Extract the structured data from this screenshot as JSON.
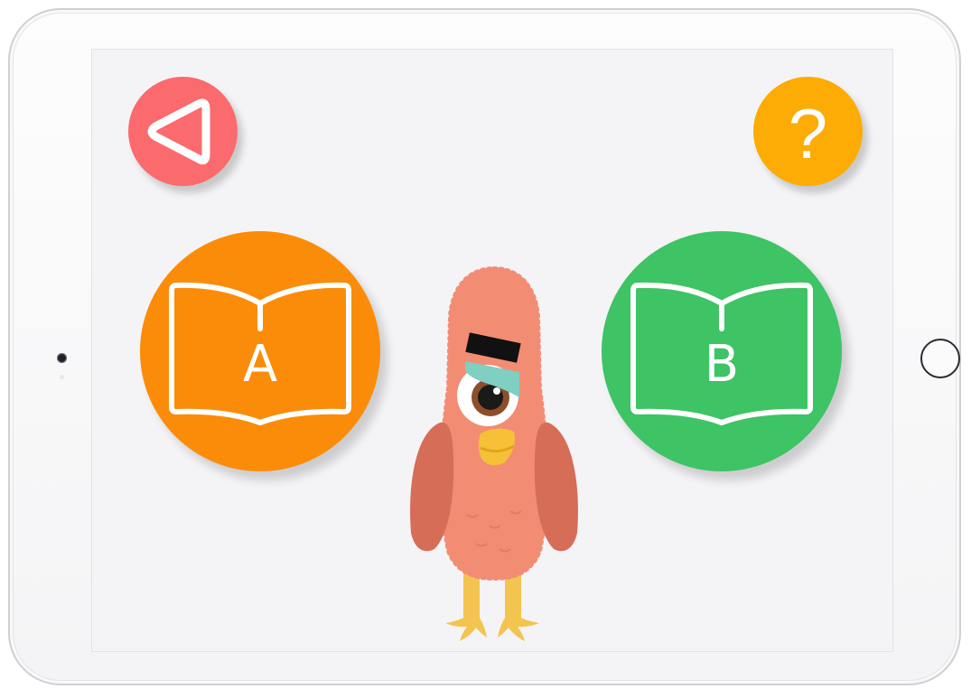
{
  "screen": {
    "back_button": {
      "icon": "back-triangle-icon",
      "color": "#fb6a6d"
    },
    "help_button": {
      "label": "?",
      "icon": "question-icon",
      "color": "#fdab05"
    },
    "books": [
      {
        "letter": "A",
        "icon": "open-book-icon",
        "color": "#fb8c0a"
      },
      {
        "letter": "B",
        "icon": "open-book-icon",
        "color": "#3ec365"
      }
    ],
    "mascot": {
      "icon": "bird-mascot"
    }
  },
  "device": {
    "frame": "tablet",
    "home_button_icon": "home-button-icon",
    "camera_icon": "camera-icon"
  }
}
